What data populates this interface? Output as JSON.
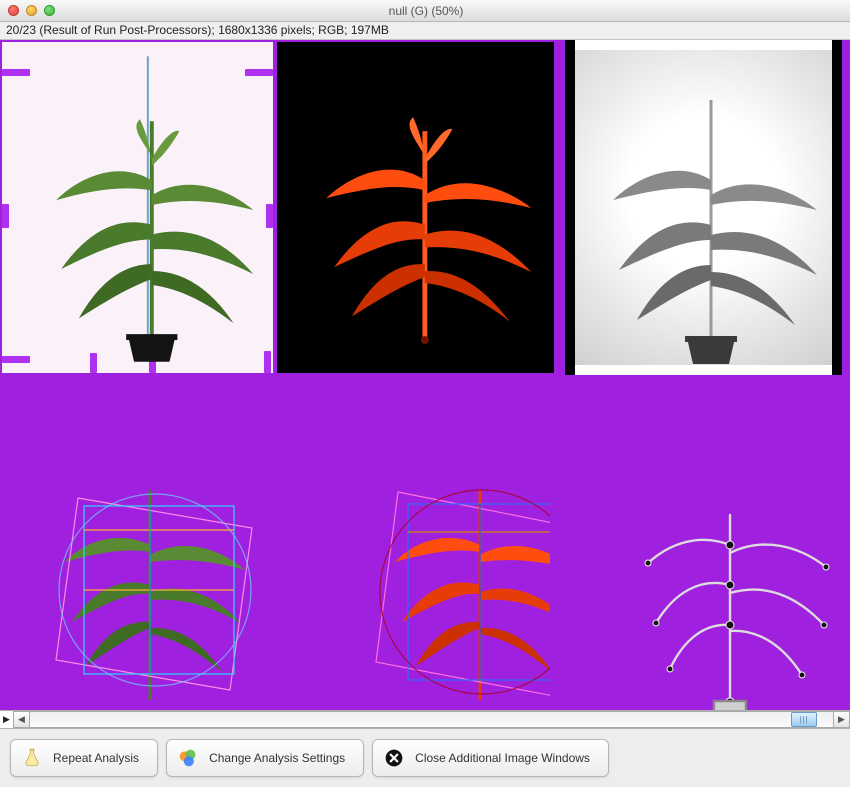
{
  "window": {
    "title": "null (G) (50%)"
  },
  "status_line": "20/23 (Result of Run Post-Processors); 1680x1336 pixels; RGB; 197MB",
  "buttons": {
    "repeat": "Repeat Analysis",
    "change": "Change Analysis Settings",
    "close_windows": "Close Additional Image Windows"
  },
  "canvas": {
    "background_color": "#a020e0",
    "marker_color": "#b030f0"
  },
  "top_panels": [
    {
      "id": "rgb",
      "desc": "RGB photo of plant on white with purple crop markers"
    },
    {
      "id": "fluo",
      "desc": "Fluorescence/IR plant rendered orange on black"
    },
    {
      "id": "gray",
      "desc": "Grayscale plant on white with black side strips"
    }
  ],
  "bottom_panels": [
    {
      "id": "rgb_overlay",
      "desc": "green plant with cyan/pink bounding wireframe and circle"
    },
    {
      "id": "fluo_overlay",
      "desc": "orange plant with blue/pink wireframe and red circle"
    },
    {
      "id": "skeleton",
      "desc": "gray skeletonized plant on purple"
    }
  ]
}
